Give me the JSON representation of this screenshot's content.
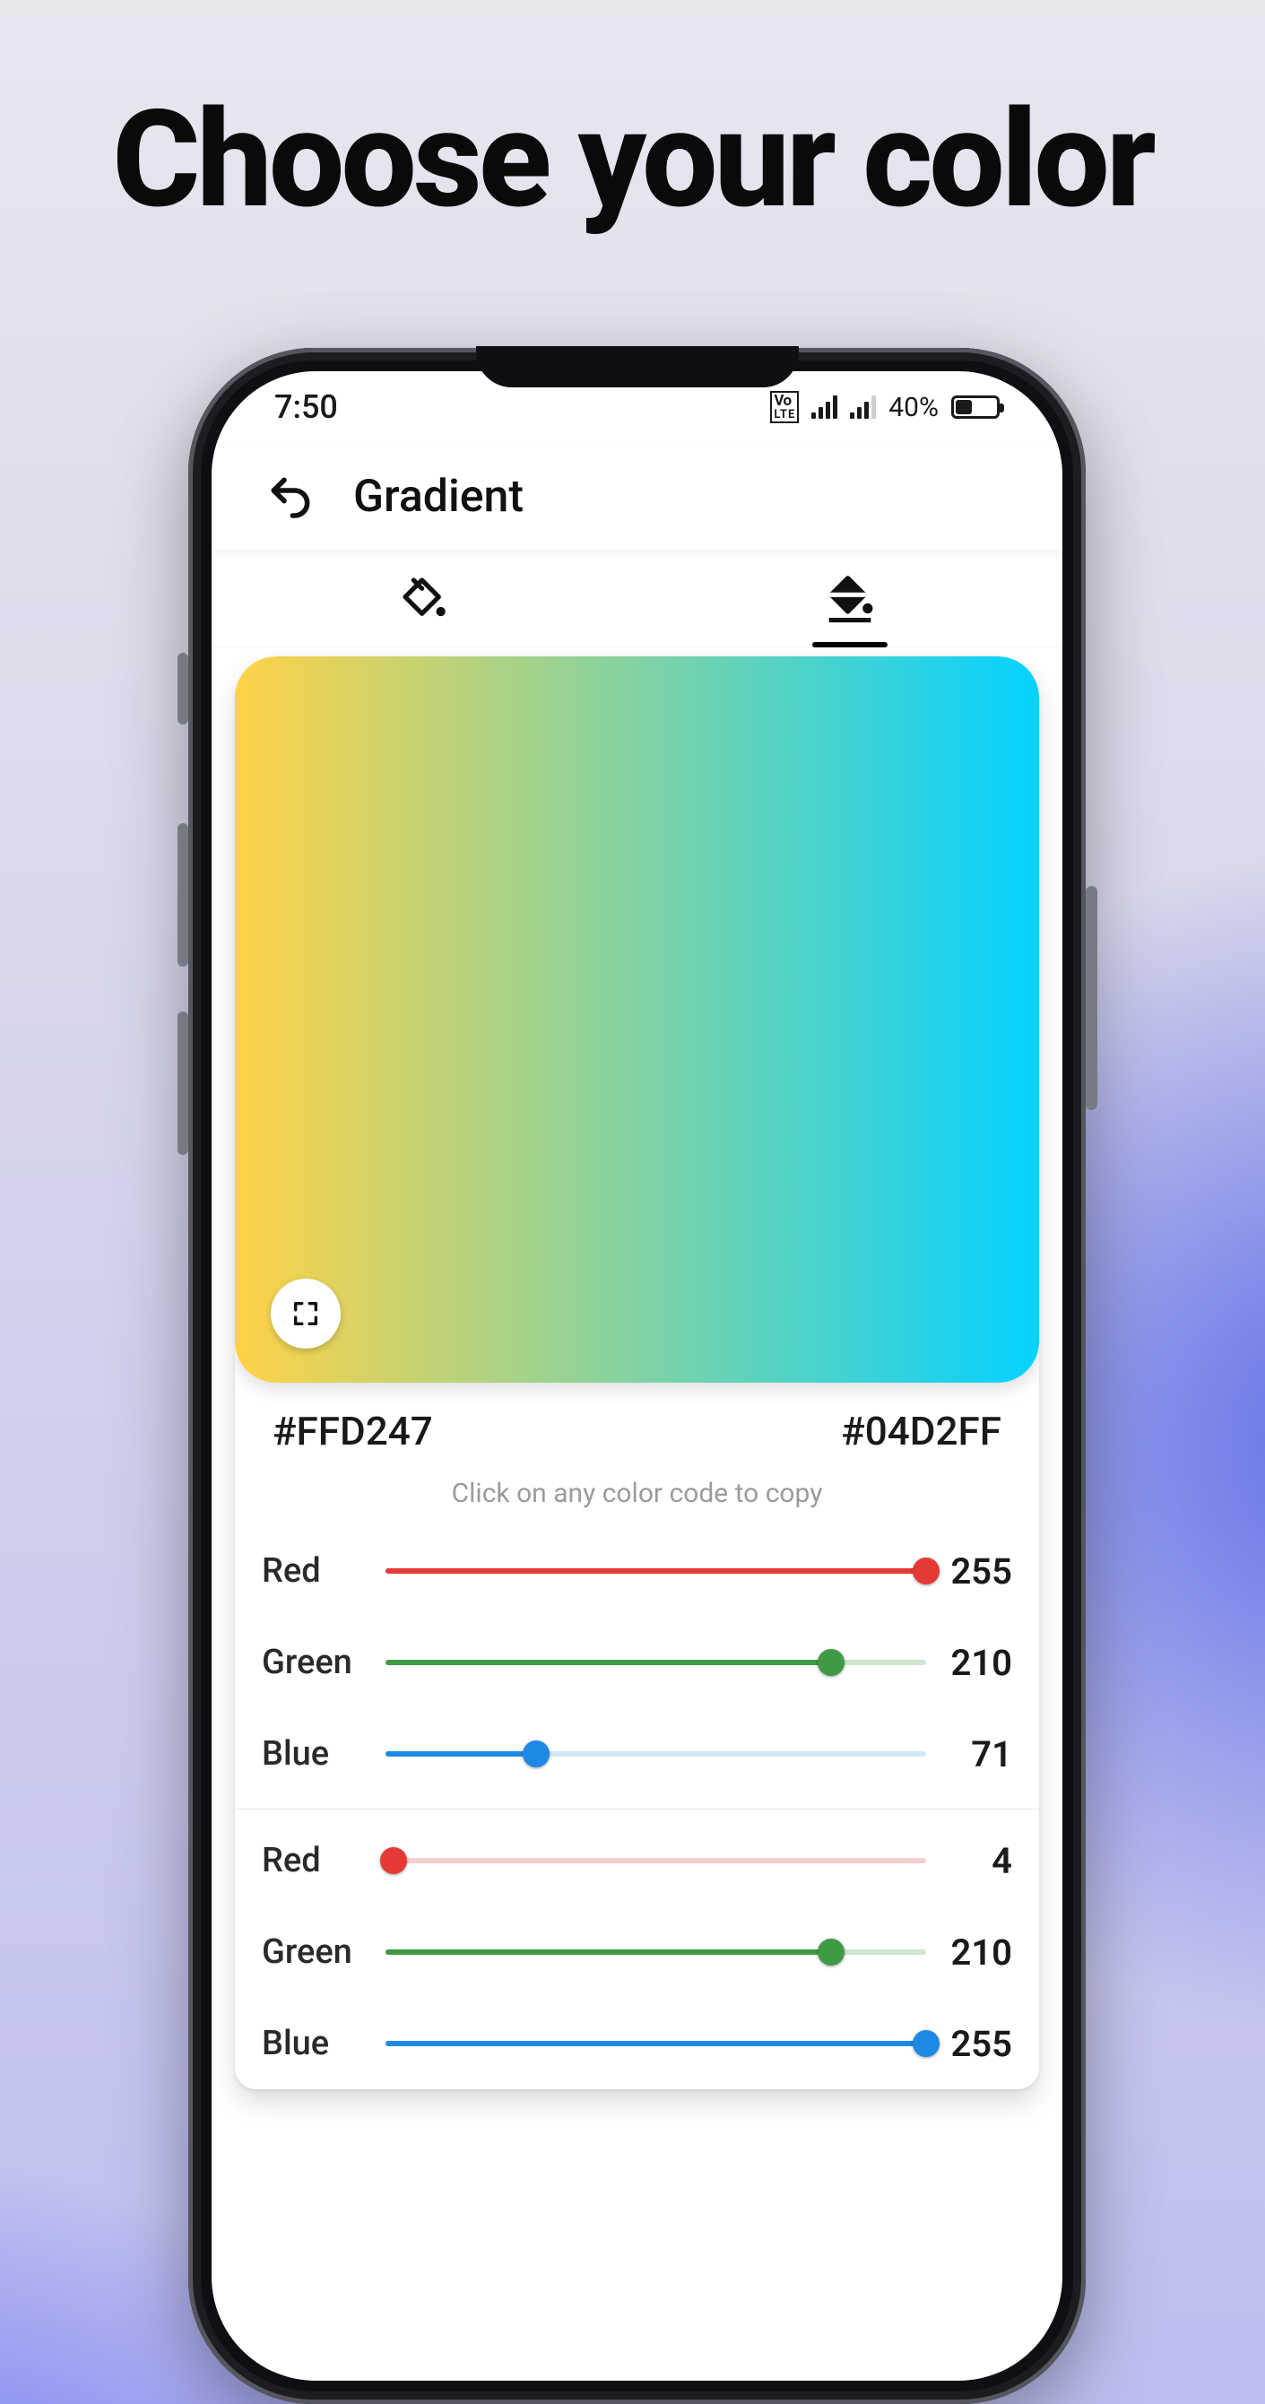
{
  "headline": "Choose your color",
  "status": {
    "time": "7:50",
    "volte_top": "Vo",
    "volte_bottom": "LTE",
    "battery_pct_label": "40%",
    "battery_pct": 40
  },
  "header": {
    "title": "Gradient"
  },
  "tabs": {
    "solid_selected": false,
    "gradient_selected": true
  },
  "gradient": {
    "left_hex": "#FFD247",
    "right_hex": "#04D2FF",
    "hint": "Click on any color code to copy"
  },
  "labels": {
    "red": "Red",
    "green": "Green",
    "blue": "Blue"
  },
  "color1": {
    "r": 255,
    "g": 210,
    "b": 71
  },
  "color2": {
    "r": 4,
    "g": 210,
    "b": 255
  },
  "slider_colors": {
    "red": {
      "fill": "#e53935",
      "track": "#f6cfcf"
    },
    "green": {
      "fill": "#3f9a46",
      "track": "#cfe6cf"
    },
    "blue": {
      "fill": "#1e88e5",
      "track": "#d2e8f8"
    }
  }
}
